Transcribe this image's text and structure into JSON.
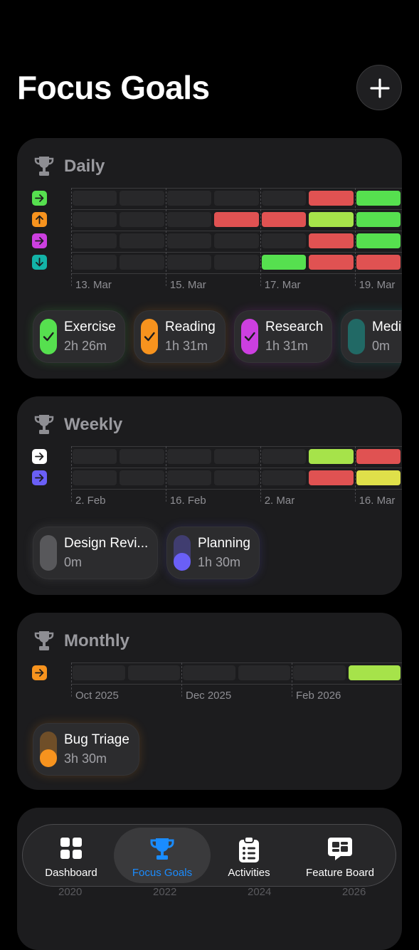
{
  "header": {
    "title": "Focus Goals"
  },
  "colors": {
    "red": "#e05252",
    "green": "#56e04f",
    "lime": "#a6e34a",
    "yellow": "#dfe04a",
    "orange": "#f7931e",
    "magenta": "#cc3fe0",
    "teal": "#13b3a8",
    "indigo": "#6a5ff7",
    "accent": "#1a8cff"
  },
  "daily": {
    "title": "Daily",
    "ticks": [
      "13. Mar",
      "15. Mar",
      "17. Mar",
      "19. Mar"
    ],
    "rows": [
      {
        "icon": "arrow-right-icon",
        "color": "#56e04f",
        "cells": [
          "",
          "",
          "",
          "",
          "",
          "red",
          "green"
        ]
      },
      {
        "icon": "arrow-up-icon",
        "color": "#f7931e",
        "cells": [
          "",
          "",
          "",
          "red",
          "red",
          "lime",
          "green"
        ]
      },
      {
        "icon": "arrow-right-icon",
        "color": "#cc3fe0",
        "cells": [
          "",
          "",
          "",
          "",
          "",
          "red",
          "green"
        ]
      },
      {
        "icon": "arrow-down-icon",
        "color": "#13b3a8",
        "cells": [
          "",
          "",
          "",
          "",
          "green",
          "red",
          "red"
        ]
      }
    ],
    "goals": [
      {
        "name": "Exercise",
        "time": "2h 26m",
        "color": "#56e04f",
        "progress": 1,
        "checked": true
      },
      {
        "name": "Reading",
        "time": "1h 31m",
        "color": "#f7931e",
        "progress": 1,
        "checked": true
      },
      {
        "name": "Research",
        "time": "1h 31m",
        "color": "#cc3fe0",
        "progress": 1,
        "checked": true
      },
      {
        "name": "Medi",
        "time": "0m",
        "color": "#13b3a8",
        "progress": 0,
        "checked": false
      }
    ]
  },
  "weekly": {
    "title": "Weekly",
    "ticks": [
      "2. Feb",
      "16. Feb",
      "2. Mar",
      "16. Mar"
    ],
    "rows": [
      {
        "icon": "arrow-right-icon",
        "color": "#ffffff",
        "cells": [
          "",
          "",
          "",
          "",
          "",
          "lime",
          "red"
        ]
      },
      {
        "icon": "arrow-right-icon",
        "color": "#6a5ff7",
        "cells": [
          "",
          "",
          "",
          "",
          "",
          "red",
          "yellow"
        ]
      }
    ],
    "goals": [
      {
        "name": "Design Revi...",
        "time": "0m",
        "color": "#8e8e93",
        "progress": 0,
        "checked": false
      },
      {
        "name": "Planning",
        "time": "1h 30m",
        "color": "#6a5ff7",
        "progress": 0.5,
        "checked": false
      }
    ]
  },
  "monthly": {
    "title": "Monthly",
    "ticks": [
      "Oct 2025",
      "Dec 2025",
      "Feb 2026"
    ],
    "rows": [
      {
        "icon": "arrow-right-icon",
        "color": "#f7931e",
        "cells": [
          "",
          "",
          "",
          "",
          "",
          "lime"
        ]
      }
    ],
    "goals": [
      {
        "name": "Bug Triage",
        "time": "3h 30m",
        "color": "#f7931e",
        "progress": 0.5,
        "checked": false
      }
    ]
  },
  "yearly_peek": {
    "ticks": [
      "2020",
      "2022",
      "2024",
      "2026"
    ]
  },
  "tabs": [
    {
      "label": "Dashboard",
      "icon": "grid-icon",
      "active": false
    },
    {
      "label": "Focus Goals",
      "icon": "trophy-icon",
      "active": true
    },
    {
      "label": "Activities",
      "icon": "clipboard-list-icon",
      "active": false
    },
    {
      "label": "Feature Board",
      "icon": "chat-board-icon",
      "active": false
    }
  ]
}
